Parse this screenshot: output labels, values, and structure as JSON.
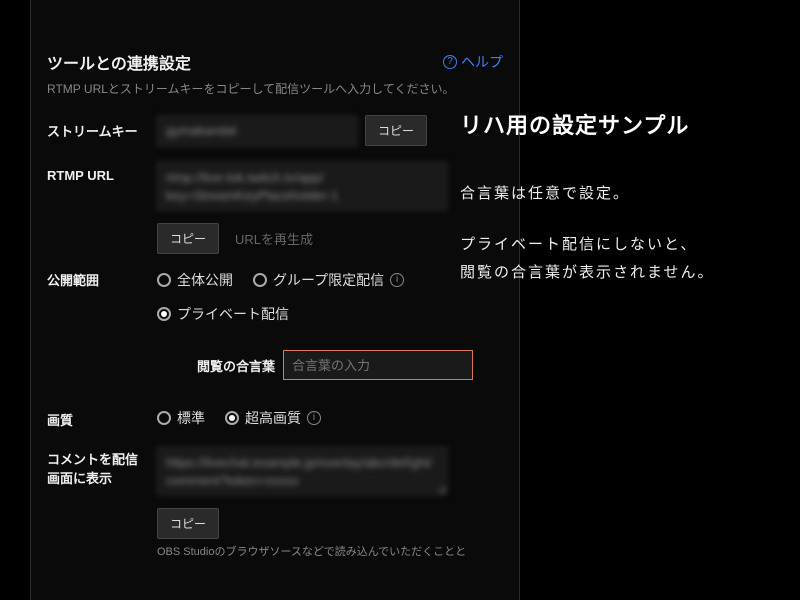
{
  "header": {
    "title": "ツールとの連携設定",
    "help_label": "ヘルプ",
    "subtext": "RTMP URLとストリームキーをコピーして配信ツールへ入力してください。"
  },
  "stream_key": {
    "label": "ストリームキー",
    "value": "gymakandal",
    "copy_label": "コピー"
  },
  "rtmp": {
    "label": "RTMP URL",
    "value": "rtmp://live-tok.twitch.tv/app/\nkey=StreamKeyPlaceholder-1",
    "copy_label": "コピー",
    "regen_label": "URLを再生成"
  },
  "visibility": {
    "label": "公開範囲",
    "options": [
      {
        "label": "全体公開",
        "checked": false
      },
      {
        "label": "グループ限定配信",
        "checked": false
      },
      {
        "label": "プライベート配信",
        "checked": true
      }
    ],
    "password_label": "閲覧の合言葉",
    "password_placeholder": "合言葉の入力"
  },
  "quality": {
    "label": "画質",
    "options": [
      {
        "label": "標準",
        "checked": false
      },
      {
        "label": "超高画質",
        "checked": true
      }
    ]
  },
  "comment": {
    "label_line1": "コメントを配信",
    "label_line2": "画面に表示",
    "value": "https://livechat.example.jp/overlay/abc/def/ghi/comment?token=xxxxx",
    "copy_label": "コピー",
    "note": "OBS Studioのブラウザソースなどで読み込んでいただくことと"
  },
  "overlay": {
    "title": "リハ用の設定サンプル",
    "p1": "合言葉は任意で設定。",
    "p2": "プライベート配信にしないと、",
    "p3": "閲覧の合言葉が表示されません。"
  }
}
